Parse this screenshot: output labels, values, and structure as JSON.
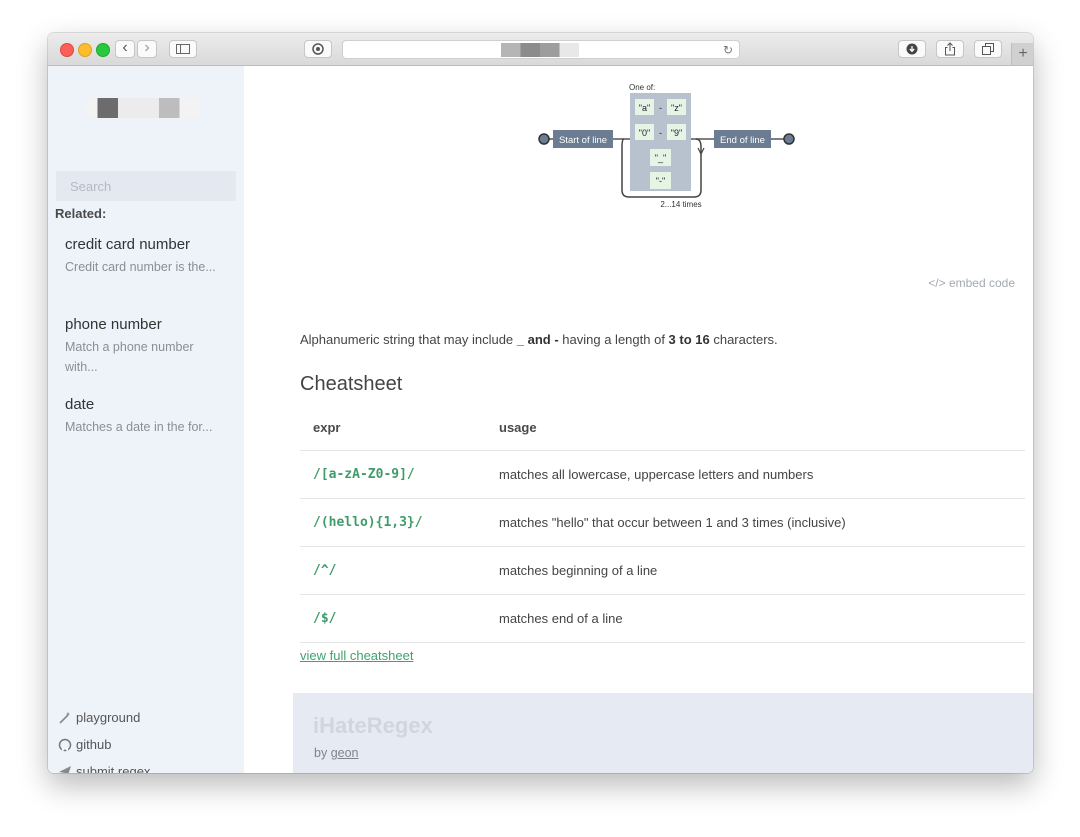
{
  "browser": {
    "nav_back": "‹",
    "nav_forward": "›",
    "reload_icon": "↻",
    "new_tab": "+"
  },
  "sidebar": {
    "search_placeholder": "Search",
    "related_heading": "Related:",
    "related": [
      {
        "title": "credit card number",
        "desc": "Credit card number is the..."
      },
      {
        "title": "phone number",
        "desc": "Match a phone number with..."
      },
      {
        "title": "date",
        "desc": "Matches a date in the for..."
      }
    ],
    "links": [
      {
        "label": "playground",
        "icon": "magic-wand-icon"
      },
      {
        "label": "github",
        "icon": "github-icon"
      },
      {
        "label": "submit regex",
        "icon": "paper-plane-icon"
      }
    ]
  },
  "diagram": {
    "one_of": "One of:",
    "start": "Start of line",
    "end": "End of line",
    "chars": [
      "\"a\"",
      "\"z\"",
      "\"0\"",
      "\"9\"",
      "\"_\"",
      "\"-\""
    ],
    "dash": "-",
    "repeat": "2...14 times"
  },
  "main": {
    "embed_code": "</> embed code",
    "description": {
      "prefix": "Alphanumeric string that may include ",
      "bold1": "_ and -",
      "middle": " having a length of ",
      "bold2": "3 to 16",
      "suffix": " characters."
    },
    "cheatsheet_title": "Cheatsheet",
    "table_headers": [
      "expr",
      "usage"
    ],
    "table_rows": [
      {
        "expr": "/[a-zA-Z0-9]/",
        "usage": "matches all lowercase, uppercase letters and numbers"
      },
      {
        "expr": "/(hello){1,3}/",
        "usage": "matches \"hello\" that occur between 1 and 3 times (inclusive)"
      },
      {
        "expr": "/^/",
        "usage": "matches beginning of a line"
      },
      {
        "expr": "/$/",
        "usage": "matches end of a line"
      }
    ],
    "full_link": "view full cheatsheet"
  },
  "footer": {
    "brand": "iHateRegex",
    "by": "by ",
    "author": "geon"
  },
  "colors": {
    "accent_green": "#3f9c6a",
    "sidebar_bg": "#eef2f9",
    "diagram_node": "#6b7c93"
  }
}
